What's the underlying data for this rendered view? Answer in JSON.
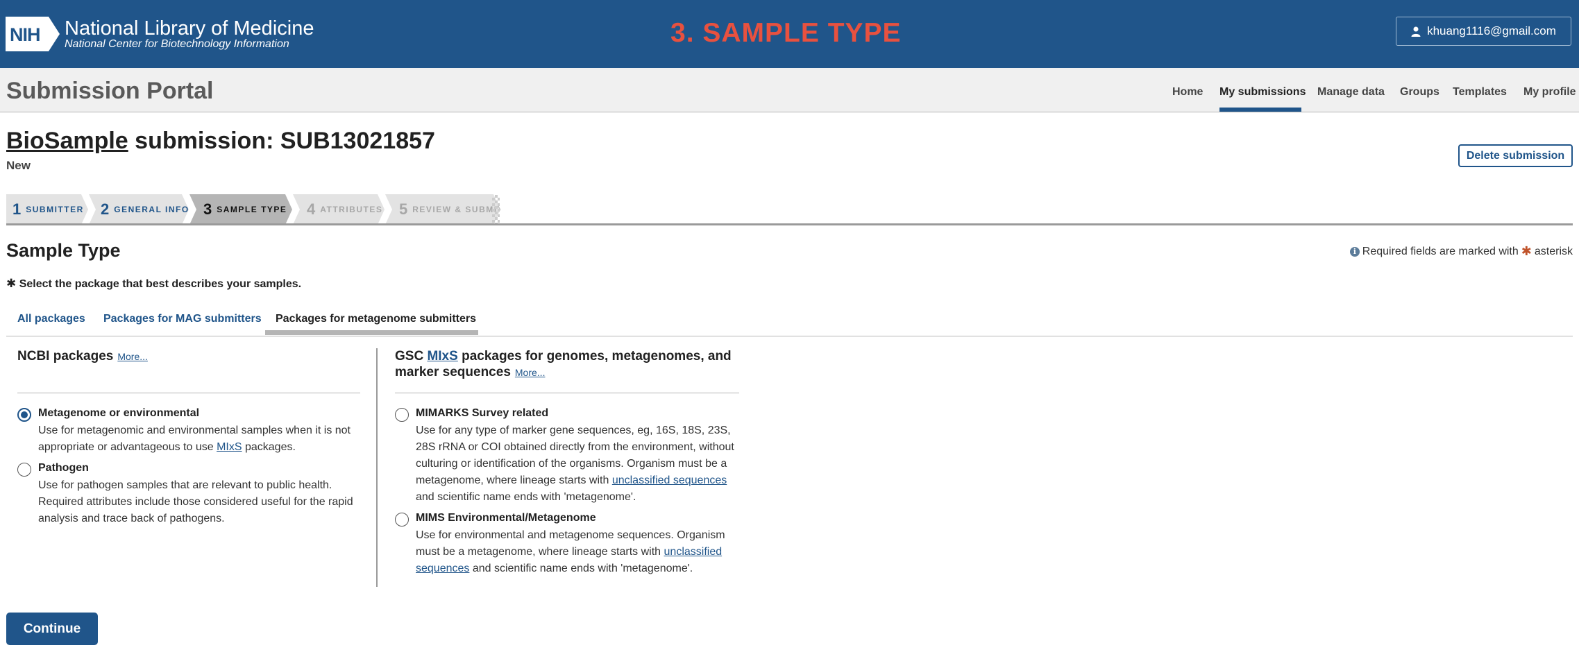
{
  "header": {
    "logo_text": "NIH",
    "title": "National Library of Medicine",
    "subtitle": "National Center for Biotechnology Information",
    "step_banner": "3. SAMPLE TYPE",
    "user_email": "khuang1116@gmail.com"
  },
  "portal": {
    "title": "Submission Portal",
    "nav": [
      "Home",
      "My submissions",
      "Manage data",
      "Groups",
      "Templates",
      "My profile"
    ],
    "active_nav": "My submissions"
  },
  "submission": {
    "link_text": "BioSample",
    "title_rest": " submission: SUB13021857",
    "status": "New",
    "delete_label": "Delete submission"
  },
  "steps": [
    {
      "num": "1",
      "label": "SUBMITTER",
      "state": "done"
    },
    {
      "num": "2",
      "label": "GENERAL INFO",
      "state": "done"
    },
    {
      "num": "3",
      "label": "SAMPLE TYPE",
      "state": "current"
    },
    {
      "num": "4",
      "label": "ATTRIBUTES",
      "state": "future"
    },
    {
      "num": "5",
      "label": "REVIEW & SUBMIT",
      "state": "future"
    }
  ],
  "section": {
    "title": "Sample Type",
    "required_note_pre": "Required fields are marked with",
    "required_note_post": "asterisk",
    "instruction": "Select the package that best describes your samples."
  },
  "tabs": [
    "All packages",
    "Packages for MAG submitters",
    "Packages for metagenome submitters"
  ],
  "active_tab": "Packages for metagenome submitters",
  "ncbi": {
    "heading": "NCBI packages",
    "more": "More...",
    "options": [
      {
        "title": "Metagenome or environmental",
        "selected": true,
        "desc_pre": "Use for metagenomic and environmental samples when it is not appropriate or advantageous to use ",
        "desc_link": "MIxS",
        "desc_post": " packages."
      },
      {
        "title": "Pathogen",
        "selected": false,
        "desc_pre": "Use for pathogen samples that are relevant to public health. Required attributes include those considered useful for the rapid analysis and trace back of pathogens."
      }
    ]
  },
  "gsc": {
    "heading_pre": "GSC ",
    "heading_link": "MIxS",
    "heading_post": " packages for genomes, metagenomes, and marker sequences",
    "more": "More...",
    "options": [
      {
        "title": "MIMARKS Survey related",
        "selected": false,
        "desc_pre": "Use for any type of marker gene sequences, eg, 16S, 18S, 23S, 28S rRNA or COI obtained directly from the environment, without culturing or identification of the organisms. Organism must be a metagenome, where lineage starts with ",
        "desc_link": "unclassified sequences",
        "desc_post": " and scientific name ends with 'metagenome'."
      },
      {
        "title": "MIMS Environmental/Metagenome",
        "selected": false,
        "desc_pre": "Use for environmental and metagenome sequences. Organism must be a metagenome, where lineage starts with ",
        "desc_link": "unclassified sequences",
        "desc_post": " and scientific name ends with 'metagenome'."
      }
    ]
  },
  "continue_label": "Continue",
  "colors": {
    "brand": "#20558a",
    "banner_step": "#e8513f",
    "asterisk": "#c0532a"
  }
}
